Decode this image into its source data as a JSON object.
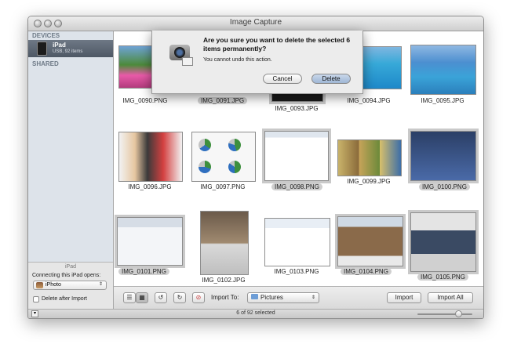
{
  "window": {
    "title": "Image Capture"
  },
  "sidebar": {
    "devices_header": "DEVICES",
    "device_name": "iPad",
    "device_sub": "USB, 92 items",
    "shared_header": "SHARED",
    "bottom_title": "iPad",
    "connecting_label": "Connecting this iPad opens:",
    "open_app": "iPhoto",
    "delete_after_import": "Delete after Import"
  },
  "thumbnails": [
    {
      "name": "IMG_0090.PNG",
      "selected": false
    },
    {
      "name": "IMG_0091.JPG",
      "selected": true
    },
    {
      "name": "IMG_0093.JPG",
      "selected": true
    },
    {
      "name": "IMG_0094.JPG",
      "selected": false
    },
    {
      "name": "IMG_0095.JPG",
      "selected": false
    },
    {
      "name": "IMG_0096.JPG",
      "selected": false
    },
    {
      "name": "IMG_0097.PNG",
      "selected": false
    },
    {
      "name": "IMG_0098.PNG",
      "selected": true
    },
    {
      "name": "IMG_0099.JPG",
      "selected": false
    },
    {
      "name": "IMG_0100.PNG",
      "selected": true
    },
    {
      "name": "IMG_0101.PNG",
      "selected": true
    },
    {
      "name": "IMG_0102.JPG",
      "selected": false
    },
    {
      "name": "IMG_0103.PNG",
      "selected": false
    },
    {
      "name": "IMG_0104.PNG",
      "selected": true
    },
    {
      "name": "IMG_0105.PNG",
      "selected": true
    }
  ],
  "toolbar": {
    "import_to_label": "Import To:",
    "import_to_value": "Pictures",
    "import_button": "Import",
    "import_all_button": "Import All"
  },
  "status": {
    "selection": "6 of 92 selected"
  },
  "dialog": {
    "title": "Are you sure you want to delete the selected 6 items permanently?",
    "message": "You cannot undo this action.",
    "cancel": "Cancel",
    "delete": "Delete"
  }
}
